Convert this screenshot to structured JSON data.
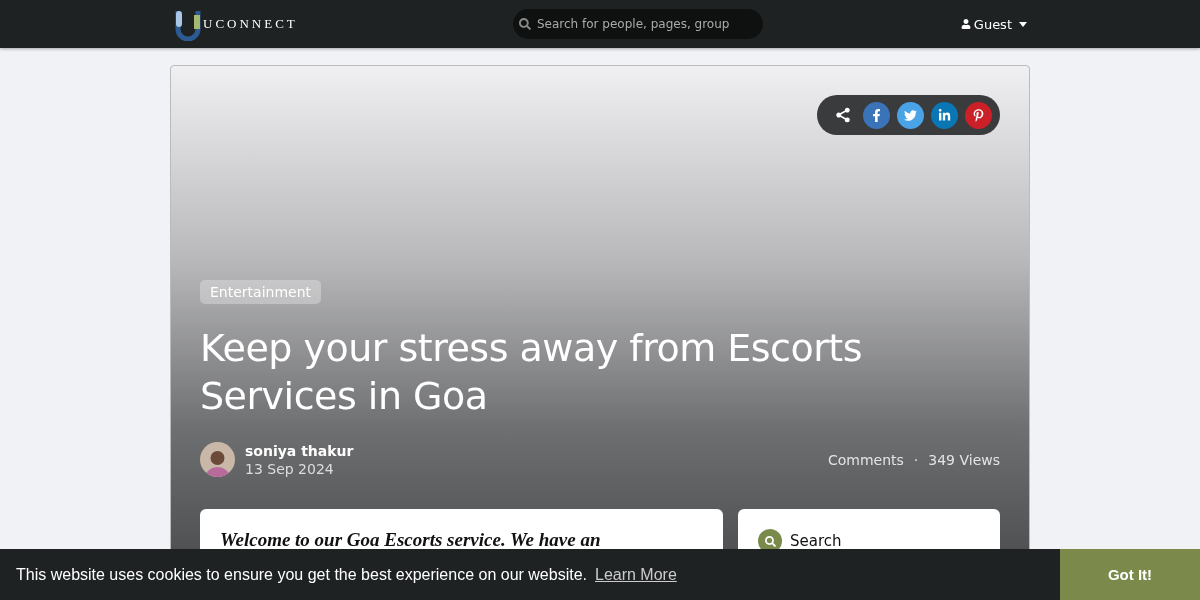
{
  "navbar": {
    "logo_text": "UCONNECT",
    "search": {
      "placeholder": "Search for people, pages, group"
    },
    "user_menu": "Guest"
  },
  "article": {
    "category": "Entertainment",
    "title": "Keep your stress away from Escorts Services in Goa",
    "author": "soniya thakur",
    "date": "13 Sep 2024",
    "comments": "Comments",
    "separator": "·",
    "views": "349 Views",
    "share": [
      {
        "kind": "share"
      },
      {
        "kind": "facebook"
      },
      {
        "kind": "twitter"
      },
      {
        "kind": "linkedin"
      },
      {
        "kind": "pinterest"
      }
    ],
    "body_text": "Welcome to our Goa Escorts service. We have an"
  },
  "sidebar": {
    "search_title": "Search"
  },
  "cookie_banner": {
    "message": "This website uses cookies to ensure you get the best experience on our website.",
    "link": "Learn More",
    "button": "Got It!"
  }
}
